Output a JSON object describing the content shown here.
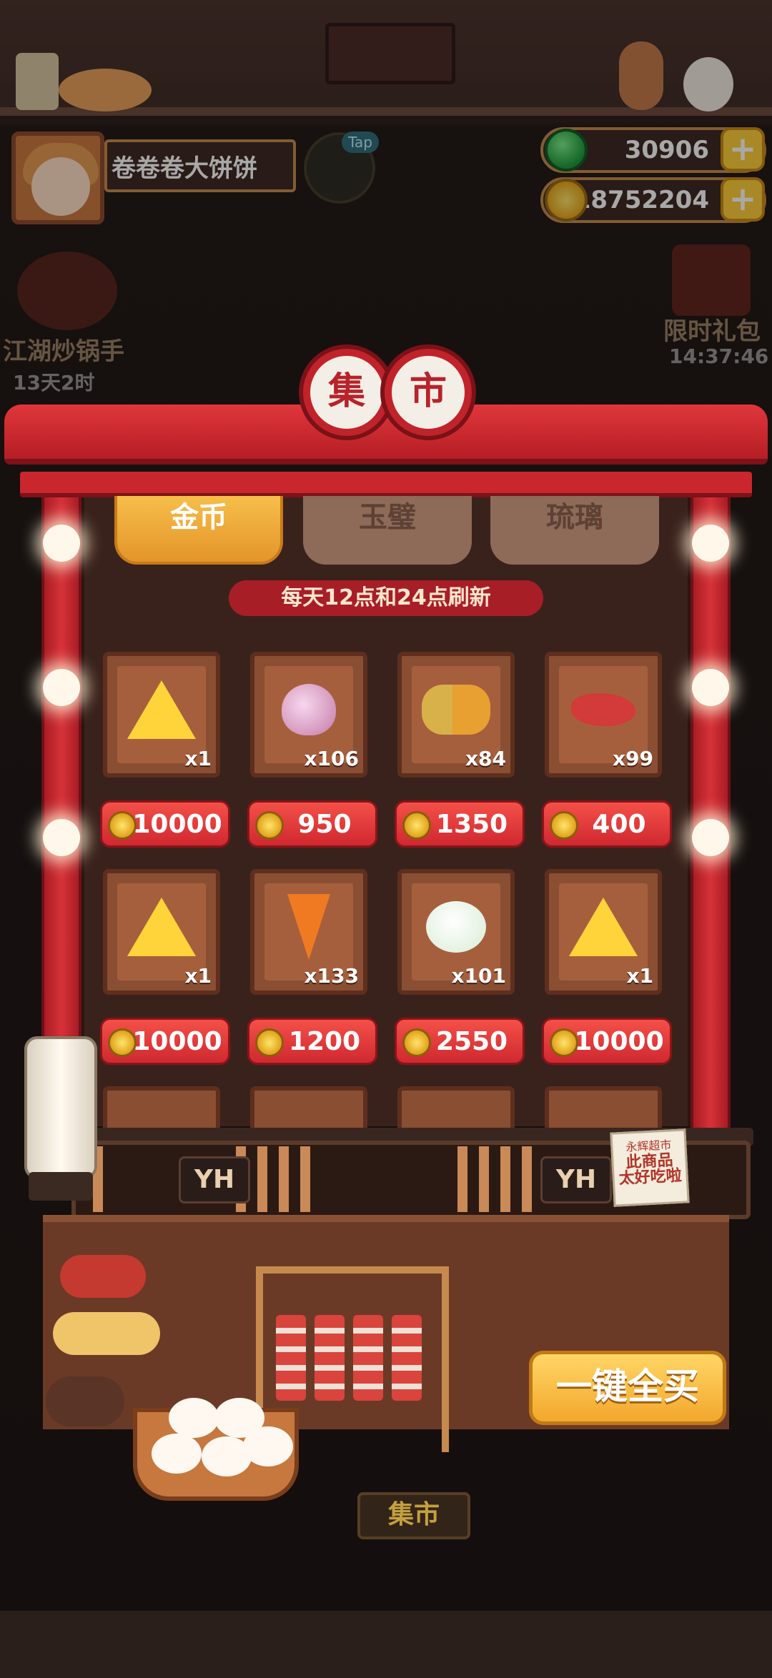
{
  "player": {
    "name": "卷卷卷大饼饼"
  },
  "tap_label": "Tap",
  "currency": {
    "jade": "30906",
    "coins": "18752204",
    "plus_symbol": "+"
  },
  "events": {
    "left": {
      "title": "江湖炒锅手",
      "time": "13天2时"
    },
    "right": {
      "title": "限时礼包",
      "time": "14:37:46"
    }
  },
  "market": {
    "title_chars": [
      "集",
      "市"
    ],
    "tabs": [
      "金币",
      "玉璧",
      "琉璃"
    ],
    "active_tab": 0,
    "refresh_note": "每天12点和24点刷新",
    "items": [
      {
        "icon": "gold-triangle-star-icon",
        "qty": "x1",
        "price": "10000"
      },
      {
        "icon": "onion-icon",
        "qty": "x106",
        "price": "950"
      },
      {
        "icon": "banana-pineapple-kiwi-icon",
        "qty": "x84",
        "price": "1350"
      },
      {
        "icon": "red-meat-icon",
        "qty": "x99",
        "price": "400"
      },
      {
        "icon": "gold-triangle-swirl-icon",
        "qty": "x1",
        "price": "10000"
      },
      {
        "icon": "carrot-icon",
        "qty": "x133",
        "price": "1200"
      },
      {
        "icon": "radish-icon",
        "qty": "x101",
        "price": "2550"
      },
      {
        "icon": "gold-triangle-swirl-icon",
        "qty": "x1",
        "price": "10000"
      }
    ],
    "counter_signs": [
      "YH",
      "YH"
    ],
    "note": {
      "line1": "永辉超市",
      "line2": "此商品",
      "line3": "太好吃啦"
    },
    "buy_all": "一键全买",
    "floor_sign": "集市"
  },
  "colors": {
    "accent_red": "#c1232b",
    "gold": "#ffcf3a",
    "panel": "#3a221c"
  }
}
